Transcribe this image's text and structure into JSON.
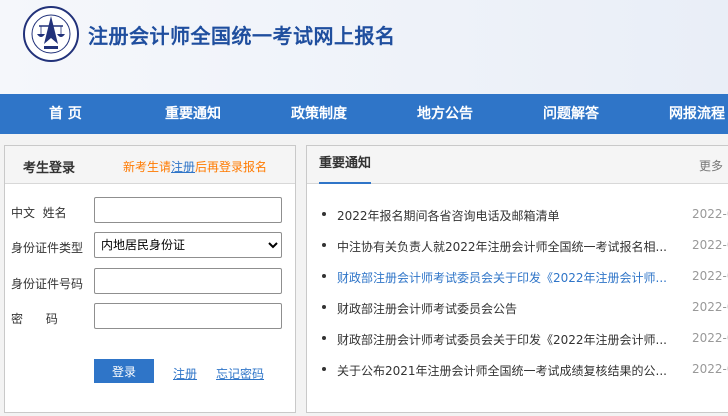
{
  "header": {
    "title": "注册会计师全国统一考试网上报名"
  },
  "nav": {
    "items": [
      {
        "label": "首 页"
      },
      {
        "label": "重要通知"
      },
      {
        "label": "政策制度"
      },
      {
        "label": "地方公告"
      },
      {
        "label": "问题解答"
      },
      {
        "label": "网报流程"
      }
    ]
  },
  "login": {
    "title": "考生登录",
    "tip_prefix": "新考生请",
    "tip_link": "注册",
    "tip_suffix": "后再登录报名",
    "fields": {
      "name_label": "中文  姓名",
      "name_value": "",
      "id_type_label": "身份证件类型",
      "id_type_value": "内地居民身份证",
      "id_no_label": "身份证件号码",
      "id_no_value": "",
      "password_label": "密      码",
      "password_value": ""
    },
    "submit_label": "登录",
    "register_label": "注册",
    "forgot_label": "忘记密码"
  },
  "notices": {
    "title": "重要通知",
    "more_label": "更多",
    "items": [
      {
        "text": "2022年报名期间各省咨询电话及邮箱清单",
        "date": "2022-0",
        "visited": false
      },
      {
        "text": "中注协有关负责人就2022年注册会计师全国统一考试报名相...",
        "date": "2022-0",
        "visited": false
      },
      {
        "text": "财政部注册会计师考试委员会关于印发《2022年注册会计师...",
        "date": "2022-0",
        "visited": true
      },
      {
        "text": "财政部注册会计师考试委员会公告",
        "date": "2022-0",
        "visited": false
      },
      {
        "text": "财政部注册会计师考试委员会关于印发《2022年注册会计师...",
        "date": "2022-0",
        "visited": false
      },
      {
        "text": "关于公布2021年注册会计师全国统一考试成绩复核结果的公...",
        "date": "2022-0",
        "visited": false
      }
    ]
  },
  "colors": {
    "nav_bg": "#2f75c8",
    "title_blue": "#1f4e9e",
    "tip_orange": "#ff7a00",
    "link_blue": "#2f75c8"
  },
  "icons": {
    "logo": "cicpa-emblem-icon"
  }
}
